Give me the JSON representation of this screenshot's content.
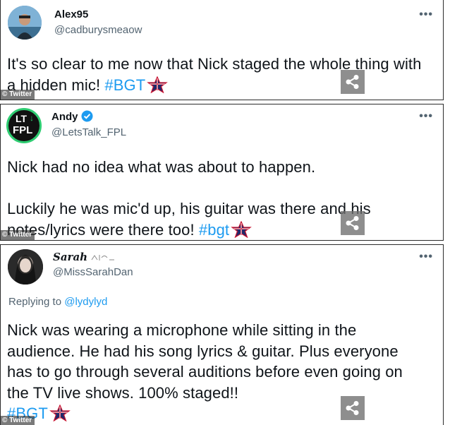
{
  "tweets": [
    {
      "name": "Alex95",
      "handle": "@cadburysmeaow",
      "more_label": "•••",
      "text": "It's so clear to me now that Nick staged the whole thing with a hidden mic!",
      "hashtag": "#BGT",
      "credit": "© Twitter"
    },
    {
      "name": "Andy",
      "handle": "@LetsTalk_FPL",
      "avatar_text_top": "LT",
      "avatar_text_bottom": "FPL",
      "verified": true,
      "more_label": "•••",
      "text1": "Nick had no idea what was about to happen.",
      "text2": "Luckily he was mic'd up, his guitar was there and his notes/lyrics were there too!",
      "hashtag": "#bgt",
      "credit": "© Twitter"
    },
    {
      "name": "𝑺𝒂𝒓𝒂𝒉",
      "handle": "@MissSarahDan",
      "more_label": "•••",
      "replying_prefix": "Replying to",
      "replying_to": "@lydylyd",
      "text": "Nick was wearing a microphone while sitting in the audience. He had his song lyrics & guitar. Plus everyone has to go through several auditions before even going on the TV live shows. 100% staged!!",
      "hashtag": "#BGT",
      "credit": "© Twitter"
    }
  ],
  "icons": {
    "share": "share-icon",
    "more": "more-options-icon",
    "verified": "verified-badge-icon",
    "flag": "union-jack-star-icon"
  },
  "colors": {
    "link": "#1d9bf0",
    "text": "#0f1419",
    "secondary": "#536471"
  }
}
